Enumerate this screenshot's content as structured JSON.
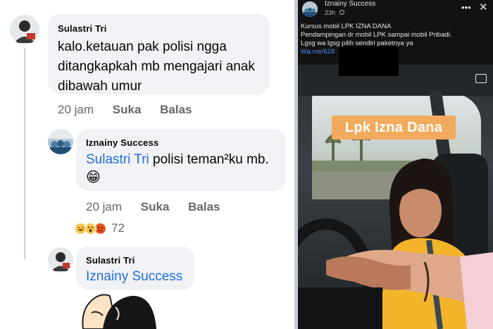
{
  "comments": [
    {
      "author": "Sulastri Tri",
      "lines": [
        "kalo.ketauan pak polisi ngga",
        "ditangkapkah mb mengajari anak",
        "dibawah umur"
      ],
      "time": "20 jam",
      "like_label": "Suka",
      "reply_label": "Balas"
    },
    {
      "author": "Iznainy Success",
      "mention": "Sulastri Tri",
      "text": "polisi teman²ku mb.",
      "emoji": "😁",
      "time": "20 jam",
      "like_label": "Suka",
      "reply_label": "Balas",
      "reaction_count": "72"
    },
    {
      "author": "Sulastri Tri",
      "mention": "Iznainy Success"
    }
  ],
  "post": {
    "page_name": "Iznainy Success",
    "time": "23h",
    "more_icon": "more-icon",
    "close_icon": "close-icon",
    "text_lines": [
      "Kursus mobil LPK IZNA DANA",
      "Pendampingan dr mobil LPK sampai mobil Pribadi.",
      "Lgsg wa lgsg pilih sendiri paketnya ya"
    ],
    "link": "Wa.me/628",
    "video_label": "Lpk Izna Dana"
  },
  "colors": {
    "bubble": "#f0f2f5",
    "mention": "#216fdb",
    "meta": "#65676b",
    "label_bg": "#f2aa5c"
  }
}
